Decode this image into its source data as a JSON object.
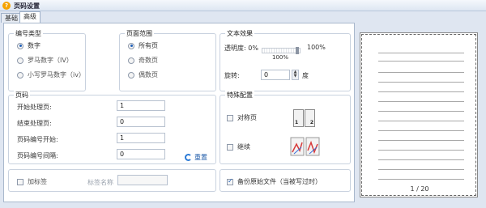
{
  "window": {
    "title": "页码设置"
  },
  "tabs": [
    {
      "label": "基础"
    },
    {
      "label": "高级"
    }
  ],
  "number_type": {
    "title": "编号类型",
    "options": [
      {
        "label": "数字",
        "selected": true
      },
      {
        "label": "罗马数字（IV）",
        "selected": false
      },
      {
        "label": "小写罗马数字（iv）",
        "selected": false
      }
    ]
  },
  "page_range": {
    "title": "页面范围",
    "options": [
      {
        "label": "所有页",
        "selected": true
      },
      {
        "label": "奇数页",
        "selected": false
      },
      {
        "label": "偶数页",
        "selected": false
      }
    ]
  },
  "text_effect": {
    "title": "文本效果",
    "opacity_label": "透明度:",
    "opacity_min": "0%",
    "opacity_max": "100%",
    "opacity_value": "100%",
    "opacity_fraction": 1.0,
    "rotation_label": "旋转:",
    "rotation_value": "0",
    "rotation_unit": "度"
  },
  "page_code": {
    "title": "页码",
    "start_page_label": "开始处理页:",
    "start_page_value": "1",
    "end_page_label": "结束处理页:",
    "end_page_value": "0",
    "number_start_label": "页码编号开始:",
    "number_start_value": "1",
    "number_interval_label": "页码编号间隔:",
    "number_interval_value": "0",
    "reset_label": "重置"
  },
  "special": {
    "title": "特殊配置",
    "facing_label": "对称页",
    "facing_checked": false,
    "continue_label": "继续",
    "continue_checked": false,
    "booklet_left": "1",
    "booklet_right": "2"
  },
  "tag": {
    "add_label": "加标签",
    "add_checked": false,
    "name_label": "标签名称",
    "name_value": ""
  },
  "backup": {
    "label": "备份原始文件（当被写过时）",
    "checked": true
  },
  "preview": {
    "page_indicator": "1 / 20"
  }
}
